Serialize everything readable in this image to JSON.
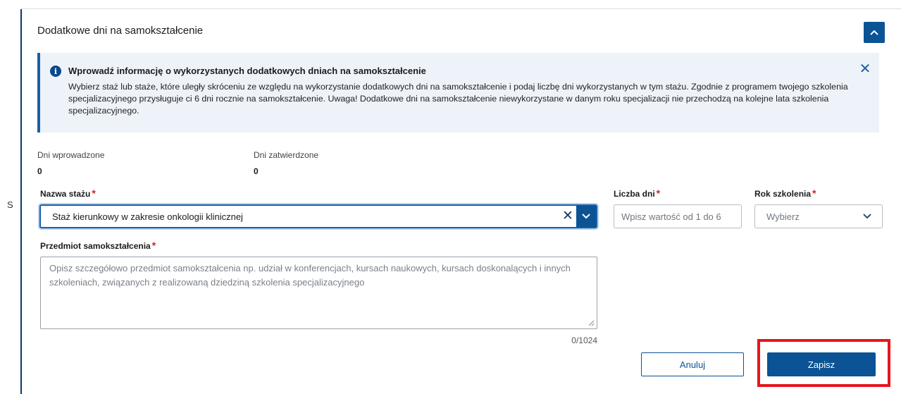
{
  "panel": {
    "title": "Dodatkowe dni na samokształcenie"
  },
  "background": {
    "partial_text": "S"
  },
  "alert": {
    "title": "Wprowadź informację o wykorzystanych dodatkowych dniach na samokształcenie",
    "body": "Wybierz staż lub staże, które uległy skróceniu ze względu na wykorzystanie dodatkowych dni na samokształcenie i podaj liczbę dni wykorzystanych w tym stażu. Zgodnie z programem twojego szkolenia specjalizacyjnego przysługuje ci 6 dni rocznie na samokształcenie. Uwaga! Dodatkowe dni na samokształcenie niewykorzystane w danym roku specjalizacji nie przechodzą na kolejne lata szkolenia specjalizacyjnego."
  },
  "stats": {
    "entered_label": "Dni wprowadzone",
    "entered_value": "0",
    "approved_label": "Dni zatwierdzone",
    "approved_value": "0"
  },
  "form": {
    "internship": {
      "label": "Nazwa stażu",
      "value": "Staż kierunkowy w zakresie onkologii klinicznej"
    },
    "days": {
      "label": "Liczba dni",
      "placeholder": "Wpisz wartość od 1 do 6",
      "value": ""
    },
    "year": {
      "label": "Rok szkolenia",
      "value": "Wybierz"
    },
    "subject": {
      "label": "Przedmiot samokształcenia",
      "placeholder": "Opisz szczegółowo przedmiot samokształcenia np. udział w konferencjach, kursach naukowych, kursach doskonalących i innych szkoleniach, związanych z realizowaną dziedziną szkolenia specjalizacyjnego",
      "counter": "0/1024"
    },
    "required_marker": "*"
  },
  "actions": {
    "cancel_label": "Anuluj",
    "save_label": "Zapisz"
  },
  "colors": {
    "primary": "#0b5394",
    "alert_bg": "#eef3fa",
    "required": "#d32020",
    "highlight": "#e8141b"
  }
}
